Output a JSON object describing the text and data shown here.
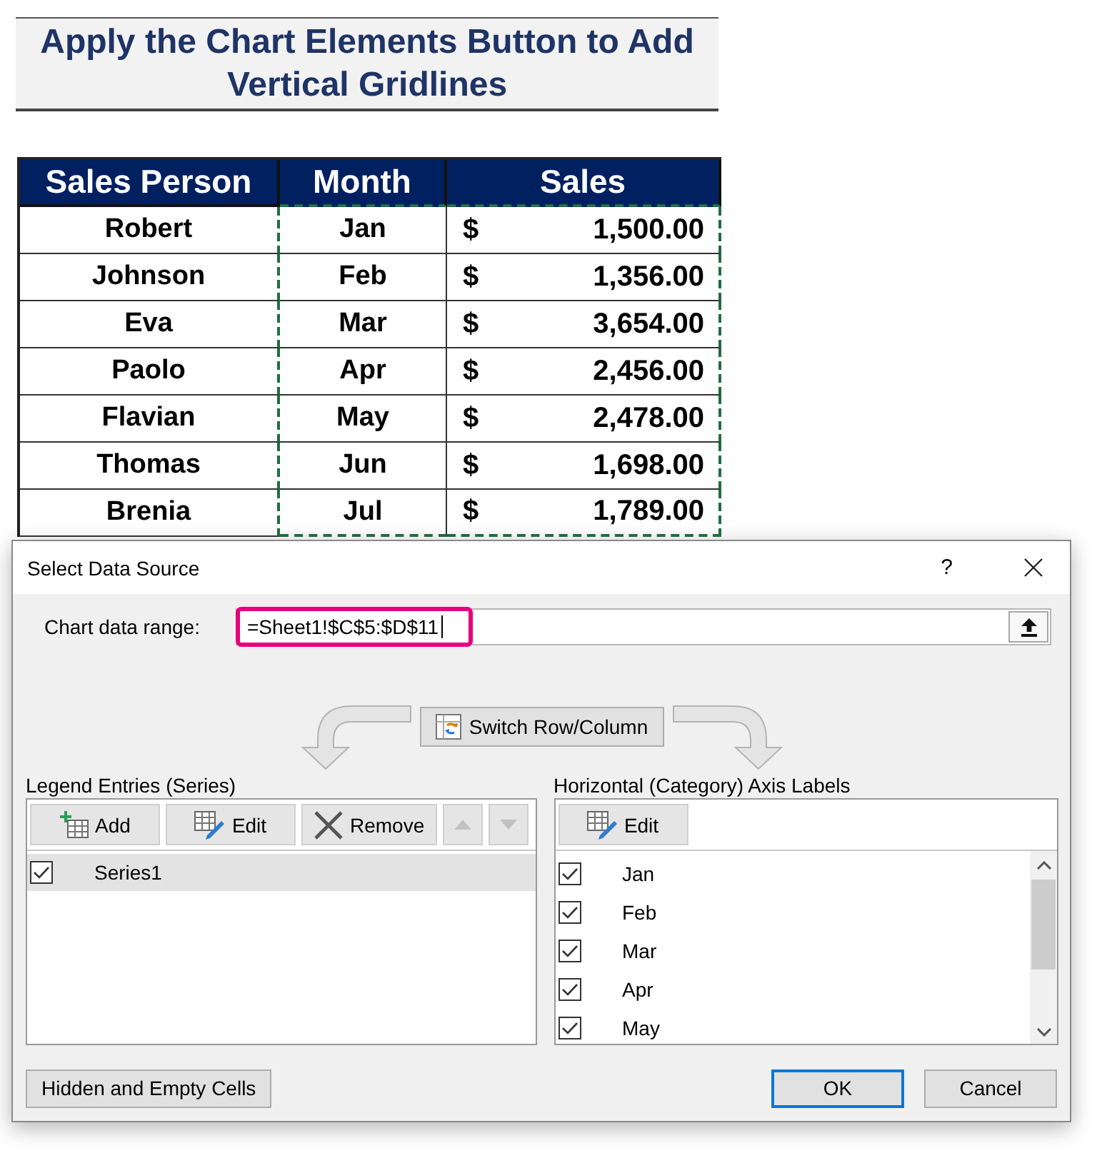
{
  "sheet_title": "Apply the Chart Elements Button to Add Vertical Gridlines",
  "table": {
    "columns": [
      {
        "label": "Sales Person",
        "in_range": false
      },
      {
        "label": "Month",
        "in_range": true
      },
      {
        "label": "Sales",
        "in_range": true
      }
    ],
    "rows": [
      {
        "sales_person": "Robert",
        "month": "Jan",
        "currency": "$",
        "amount": "1,500.00"
      },
      {
        "sales_person": "Johnson",
        "month": "Feb",
        "currency": "$",
        "amount": "1,356.00"
      },
      {
        "sales_person": "Eva",
        "month": "Mar",
        "currency": "$",
        "amount": "3,654.00"
      },
      {
        "sales_person": "Paolo",
        "month": "Apr",
        "currency": "$",
        "amount": "2,456.00"
      },
      {
        "sales_person": "Flavian",
        "month": "May",
        "currency": "$",
        "amount": "2,478.00"
      },
      {
        "sales_person": "Thomas",
        "month": "Jun",
        "currency": "$",
        "amount": "1,698.00"
      },
      {
        "sales_person": "Brenia",
        "month": "Jul",
        "currency": "$",
        "amount": "1,789.00"
      }
    ]
  },
  "dialog": {
    "title": "Select Data Source",
    "help": "?",
    "range_field": {
      "label": "Chart data range:",
      "value": "=Sheet1!$C$5:$D$11",
      "focused": true,
      "highlighted": true
    },
    "switch_button": {
      "label": "Switch Row/Column"
    },
    "legend_entries": {
      "title": "Legend Entries (Series)",
      "toolbar": [
        {
          "kind": "add",
          "label": "Add",
          "disabled": false
        },
        {
          "kind": "edit",
          "label": "Edit",
          "disabled": false
        },
        {
          "kind": "remove",
          "label": "Remove",
          "disabled": false
        },
        {
          "kind": "move-up",
          "disabled": true
        },
        {
          "kind": "move-down",
          "disabled": true
        }
      ],
      "items": [
        {
          "label": "Series1",
          "checked": true,
          "selected": true
        }
      ]
    },
    "axis_labels": {
      "title": "Horizontal (Category) Axis Labels",
      "toolbar": [
        {
          "kind": "edit",
          "label": "Edit",
          "disabled": false
        }
      ],
      "items": [
        {
          "label": "Jan",
          "checked": true,
          "selected": false
        },
        {
          "label": "Feb",
          "checked": true,
          "selected": false
        },
        {
          "label": "Mar",
          "checked": true,
          "selected": false
        },
        {
          "label": "Apr",
          "checked": true,
          "selected": false
        },
        {
          "label": "May",
          "checked": true,
          "selected": false
        }
      ]
    },
    "hidden_cells_button": {
      "label": "Hidden and Empty Cells"
    },
    "buttons": [
      {
        "label": "OK",
        "default": true
      },
      {
        "label": "Cancel",
        "default": false
      }
    ]
  }
}
